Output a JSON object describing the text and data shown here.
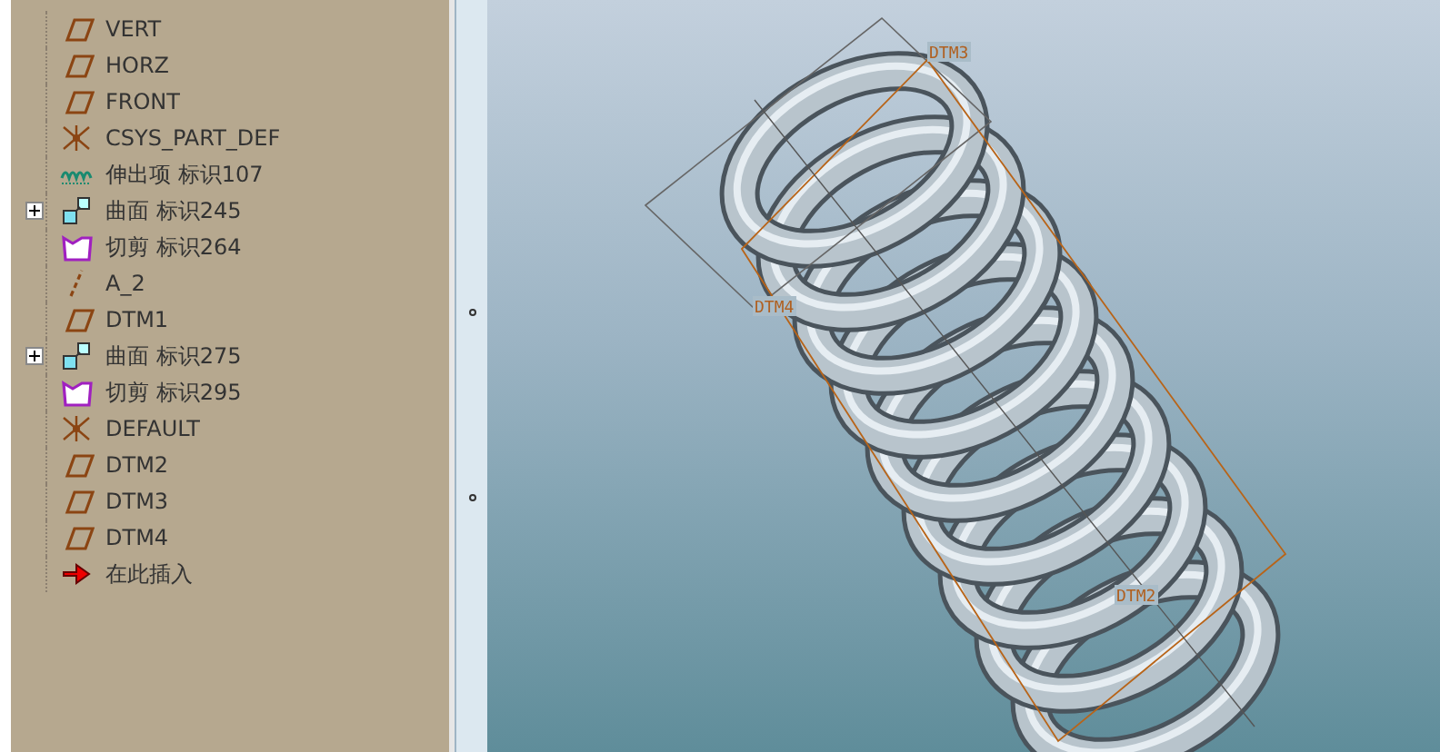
{
  "model_tree": {
    "items": [
      {
        "label": "VERT",
        "kind": "plane"
      },
      {
        "label": "HORZ",
        "kind": "plane"
      },
      {
        "label": "FRONT",
        "kind": "plane"
      },
      {
        "label": "CSYS_PART_DEF",
        "kind": "csys"
      },
      {
        "label": "伸出项 标识107",
        "kind": "protrusion"
      },
      {
        "label": "曲面 标识245",
        "kind": "surface",
        "expanded": false
      },
      {
        "label": "切剪 标识264",
        "kind": "cut"
      },
      {
        "label": "A_2",
        "kind": "axis"
      },
      {
        "label": "DTM1",
        "kind": "plane"
      },
      {
        "label": "曲面 标识275",
        "kind": "surface",
        "expanded": false
      },
      {
        "label": "切剪 标识295",
        "kind": "cut"
      },
      {
        "label": "DEFAULT",
        "kind": "csys"
      },
      {
        "label": "DTM2",
        "kind": "plane"
      },
      {
        "label": "DTM3",
        "kind": "plane"
      },
      {
        "label": "DTM4",
        "kind": "plane"
      },
      {
        "label": "在此插入",
        "kind": "insert"
      }
    ]
  },
  "viewport": {
    "datum_labels": [
      "DTM3",
      "DTM4",
      "DTM2"
    ]
  }
}
